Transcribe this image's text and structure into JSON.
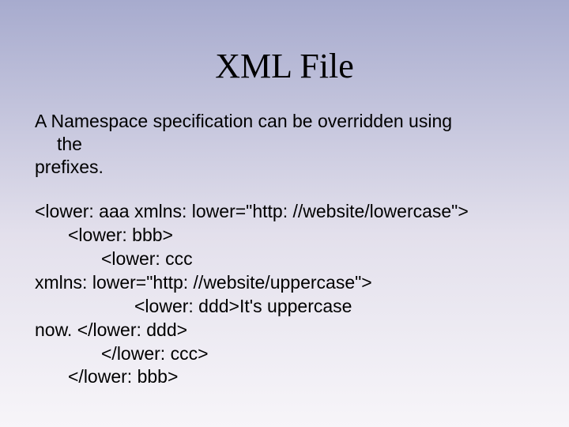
{
  "title": "XML File",
  "intro": {
    "line1": "A Namespace specification can be overridden using",
    "line2": "the",
    "line3": "prefixes."
  },
  "code": {
    "l1": "<lower: aaa xmlns: lower=\"http: //website/lowercase\">",
    "l2": "<lower: bbb>",
    "l3": "<lower: ccc",
    "l4": "xmlns: lower=\"http: //website/uppercase\">",
    "l5": "<lower: ddd>It's uppercase",
    "l6": "now. </lower: ddd>",
    "l7": "</lower: ccc>",
    "l8": "</lower: bbb>"
  }
}
